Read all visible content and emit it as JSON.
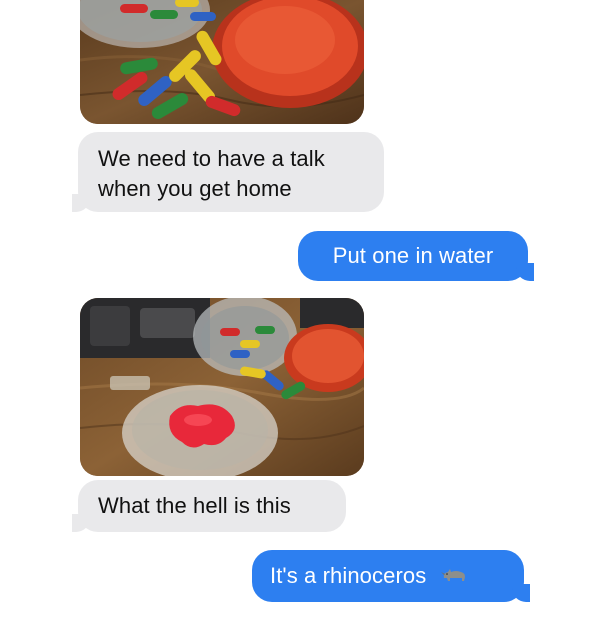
{
  "conversation": {
    "messages": [
      {
        "side": "incoming",
        "type": "image",
        "image": "pill-capsules-and-red-lid-on-wooden-table"
      },
      {
        "side": "incoming",
        "type": "text",
        "text": "We need to have a talk when you get home"
      },
      {
        "side": "outgoing",
        "type": "text",
        "text": "Put one in water"
      },
      {
        "side": "incoming",
        "type": "image",
        "image": "red-gummy-shape-in-water-bowl-on-wooden-table"
      },
      {
        "side": "incoming",
        "type": "text",
        "text": "What the hell is this"
      },
      {
        "side": "outgoing",
        "type": "text",
        "text": "It's a rhinoceros",
        "emoji": "rhinoceros-emoji"
      }
    ]
  },
  "colors": {
    "incoming_bubble": "#e9e9eb",
    "outgoing_bubble": "#2d7ff0",
    "background": "#ffffff"
  }
}
